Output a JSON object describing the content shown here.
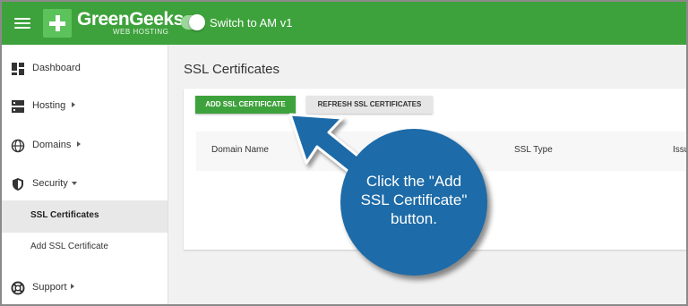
{
  "header": {
    "logo_name": "GreenGeeks",
    "logo_tagline": "WEB HOSTING",
    "switch_label": "Switch to AM v1",
    "accent_color": "#3ea23c"
  },
  "sidebar": {
    "items": [
      {
        "label": "Dashboard",
        "icon": "dashboard-icon"
      },
      {
        "label": "Hosting",
        "icon": "server-icon"
      },
      {
        "label": "Domains",
        "icon": "globe-icon"
      },
      {
        "label": "Security",
        "icon": "shield-icon"
      },
      {
        "label": "SSL Certificates"
      },
      {
        "label": "Add SSL Certificate"
      },
      {
        "label": "Support",
        "icon": "lifebuoy-icon"
      }
    ]
  },
  "main": {
    "title": "SSL Certificates",
    "add_button": "ADD SSL CERTIFICATE",
    "refresh_button": "REFRESH SSL CERTIFICATES",
    "columns": [
      "Domain Name",
      "SSL Type",
      "Issu"
    ]
  },
  "callout": {
    "lines": [
      "Click the \"Add",
      "SSL Certificate\"",
      "button."
    ],
    "color": "#1d6ba8"
  }
}
